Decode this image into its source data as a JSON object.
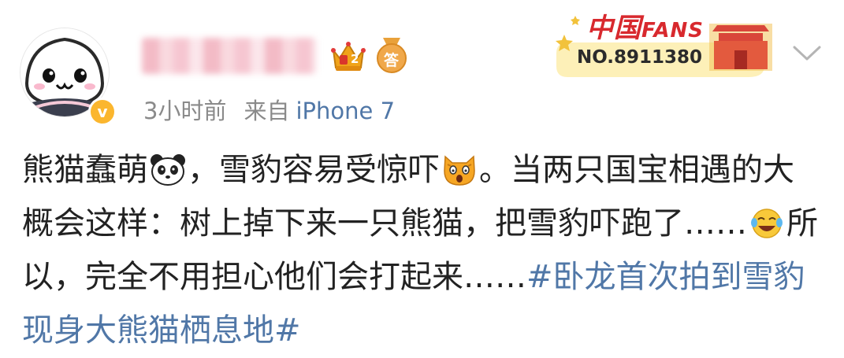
{
  "user": {
    "vip_level": "2",
    "answer_badge": "答",
    "verified_mark": "v"
  },
  "post": {
    "time": "3小时前",
    "source_prefix": "来自",
    "device": "iPhone 7",
    "segment_1": "熊猫蠢萌",
    "segment_2": "，雪豹容易受惊吓",
    "segment_3": "。当两只国宝相遇的大概会这样：树上掉下来一只熊猫，把雪豹吓跑了……",
    "segment_4": "所以，完全不用担心他们会打起来……",
    "hashtag": "#卧龙首次拍到雪豹现身大熊猫栖息地#"
  },
  "fans_card": {
    "title_cn": "中国",
    "title_en": "FANS",
    "number": "NO.8911380"
  },
  "colors": {
    "link": "#5077a7",
    "meta": "#8a8a8a",
    "fans_red": "#d8292e",
    "verified": "#fbb62e"
  },
  "icons": [
    "avatar",
    "crown-icon",
    "answer-medal-icon",
    "panda-emoji",
    "scared-cat-emoji",
    "laugh-cry-emoji",
    "chevron-down-icon"
  ]
}
